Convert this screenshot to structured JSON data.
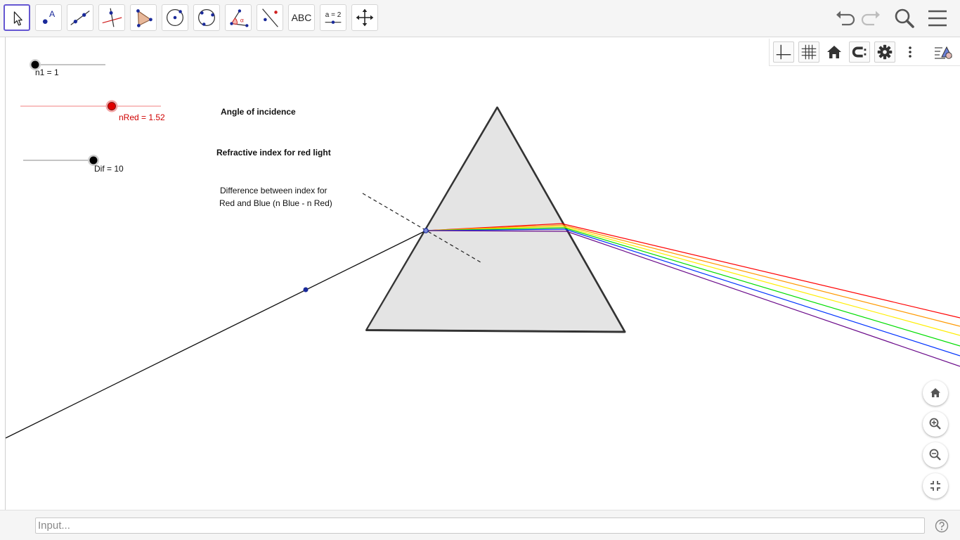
{
  "toolbar": {
    "tools": [
      {
        "name": "Move",
        "icon": "cursor-arrow-icon"
      },
      {
        "name": "Point",
        "icon": "point-icon",
        "glyph": "A"
      },
      {
        "name": "Line",
        "icon": "line-through-points-icon"
      },
      {
        "name": "Perpendicular Line",
        "icon": "perpendicular-line-icon"
      },
      {
        "name": "Polygon",
        "icon": "polygon-icon"
      },
      {
        "name": "Circle with Center through Point",
        "icon": "circle-center-icon"
      },
      {
        "name": "Circle through 3 Points",
        "icon": "circle-three-points-icon"
      },
      {
        "name": "Angle",
        "icon": "angle-icon",
        "glyph": "α"
      },
      {
        "name": "Reflect about Line",
        "icon": "reflect-icon"
      },
      {
        "name": "Text",
        "icon": "text-tool-icon",
        "label": "ABC"
      },
      {
        "name": "Slider",
        "icon": "slider-icon",
        "label": "a = 2"
      },
      {
        "name": "Move Graphics View",
        "icon": "move-view-icon"
      }
    ],
    "header_buttons": [
      "undo-icon",
      "redo-icon",
      "search-icon",
      "menu-icon"
    ]
  },
  "style_bar": {
    "buttons": [
      "axes-icon",
      "grid-icon",
      "home-icon",
      "point-capturing-icon",
      "gear-icon",
      "more-vert-icon",
      "style-bar-toggle-icon"
    ]
  },
  "sliders": {
    "n1": {
      "label": "n1 = 1",
      "value": 1
    },
    "nRed": {
      "label": "nRed = 1.52",
      "value": 1.52,
      "color": "#d00000"
    },
    "dif": {
      "label": "Dif = 10",
      "value": 10
    }
  },
  "annotations": {
    "angle_label": "Angle of incidence",
    "red_index_label": "Refractive index for red light",
    "difference_line1": "Difference between index for",
    "difference_line2": "Red and Blue (n Blue - n Red)"
  },
  "spectrum_colors": [
    "#ff0000",
    "#ff9900",
    "#ffee00",
    "#00dd00",
    "#0033ff",
    "#6a0a8a"
  ],
  "zoom_controls": [
    "standard-view-icon",
    "zoom-in-icon",
    "zoom-out-icon",
    "fullscreen-exit-icon"
  ],
  "input_bar": {
    "placeholder": "Input..."
  }
}
